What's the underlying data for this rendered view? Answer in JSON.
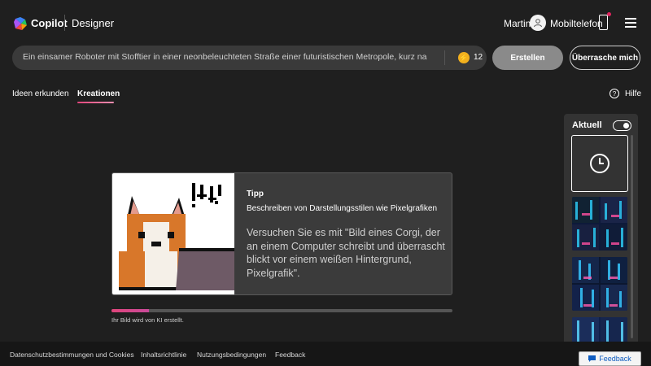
{
  "header": {
    "brand": "Copilot",
    "product": "Designer",
    "user_name": "Martin",
    "mobile_label": "Mobiltelefon"
  },
  "prompt": {
    "text": "Ein einsamer Roboter mit Stofftier in einer neonbeleuchteten Straße einer futuristischen Metropole, kurz nach",
    "boost_count": "12",
    "create_label": "Erstellen",
    "surprise_label": "Überrasche mich"
  },
  "tabs": [
    {
      "label": "Ideen erkunden",
      "active": false
    },
    {
      "label": "Kreationen",
      "active": true
    }
  ],
  "help_label": "Hilfe",
  "tip": {
    "title": "Tipp",
    "subtitle": "Beschreiben von Darstellungsstilen wie Pixelgrafiken",
    "body": "Versuchen Sie es mit \"Bild eines Corgi, der an einem Computer schreibt und überrascht blickt vor einem weißen Hintergrund, Pixelgrafik\"."
  },
  "progress": {
    "value": 0.11,
    "label": "Ihr Bild wird von KI erstellt."
  },
  "panel": {
    "title": "Aktuell",
    "toggle_on": true
  },
  "footer": {
    "links": [
      "Datenschutzbestimmungen und Cookies",
      "Inhaltsrichtlinie",
      "Nutzungsbedingungen",
      "Feedback"
    ]
  },
  "feedback_button": "Feedback",
  "colors": {
    "background": "#1f1f1f",
    "accent": "#e0457b",
    "boost": "#f2b01e"
  }
}
